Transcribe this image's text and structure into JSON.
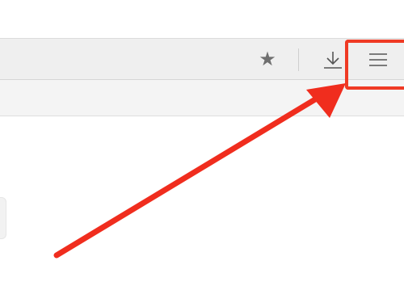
{
  "toolbar": {
    "bookmark_star": "★",
    "download_icon": "download-icon",
    "menu_icon": "hamburger-menu-icon"
  },
  "annotation": {
    "highlight_color": "#ef3a24",
    "arrow_color": "#f02d1e"
  }
}
